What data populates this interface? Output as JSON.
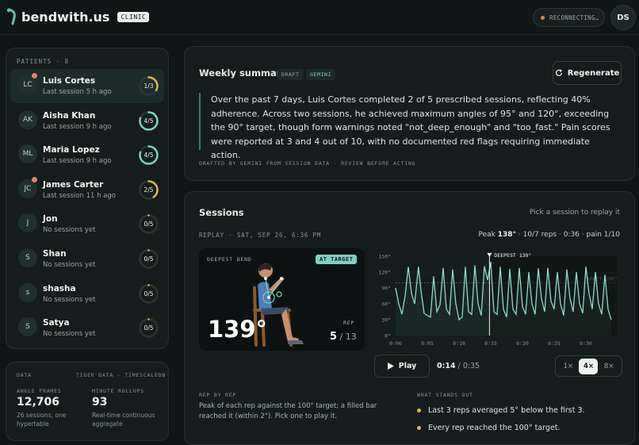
{
  "brand": {
    "name": "bendwith.us",
    "badge": "CLINIC"
  },
  "status": {
    "label": "RECONNECTING…"
  },
  "user": {
    "initials": "DS"
  },
  "patients": {
    "header": "PATIENTS · 8",
    "items": [
      {
        "initials": "LC",
        "name": "Luis Cortes",
        "sub": "Last session 5 h ago",
        "progress": "1/3",
        "fraction": 0.33,
        "color": "#e0b553",
        "alert": true,
        "active": true
      },
      {
        "initials": "AK",
        "name": "Aisha Khan",
        "sub": "Last session 9 h ago",
        "progress": "4/5",
        "fraction": 0.8,
        "color": "#7fd1c2",
        "alert": false
      },
      {
        "initials": "ML",
        "name": "Maria Lopez",
        "sub": "Last session 9 h ago",
        "progress": "4/5",
        "fraction": 0.8,
        "color": "#7fd1c2",
        "alert": false
      },
      {
        "initials": "JC",
        "name": "James Carter",
        "sub": "Last session 11 h ago",
        "progress": "2/5",
        "fraction": 0.4,
        "color": "#e0b553",
        "alert": true
      },
      {
        "initials": "J",
        "name": "Jon",
        "sub": "No sessions yet",
        "progress": "0/5",
        "fraction": 0,
        "color": "#e0b553",
        "alert": false
      },
      {
        "initials": "S",
        "name": "Shan",
        "sub": "No sessions yet",
        "progress": "0/5",
        "fraction": 0,
        "color": "#e0b553",
        "alert": false
      },
      {
        "initials": "s",
        "name": "shasha",
        "sub": "No sessions yet",
        "progress": "0/5",
        "fraction": 0,
        "color": "#e0b553",
        "alert": false
      },
      {
        "initials": "S",
        "name": "Satya",
        "sub": "No sessions yet",
        "progress": "0/5",
        "fraction": 0,
        "color": "#e0b553",
        "alert": false
      }
    ]
  },
  "data_panel": {
    "header_left": "DATA",
    "header_right": "TIGER DATA · TIMESCALEDB",
    "angle_label": "ANGLE FRAMES",
    "angle_value": "12,706",
    "angle_note": "26 sessions, one hypertable",
    "rollup_label": "MINUTE ROLLUPS",
    "rollup_value": "93",
    "rollup_note": "Real-time continuous aggregate"
  },
  "summary": {
    "title": "Weekly summary",
    "tag_draft": "DRAFT",
    "tag_gemini": "GEMINI",
    "regenerate": "Regenerate",
    "text": "Over the past 7 days, Luis Cortes completed 2 of 5 prescribed sessions, reflecting 40% adherence. Across two sessions, he achieved maximum angles of 95° and 120°, exceeding the 90° target, though form warnings noted \"not_deep_enough\" and \"too_fast.\" Pain scores were reported at 3 and 4 out of 10, with no documented red flags requiring immediate action.",
    "footer": "DRAFTED BY GEMINI FROM SESSION DATA · REVIEW BEFORE ACTING"
  },
  "sessions": {
    "title": "Sessions",
    "hint": "Pick a session to replay it",
    "replay": "REPLAY · SAT, SEP 26, 6:36 PM",
    "stats_prefix": "Peak ",
    "stats_peak": "138°",
    "stats_rest": " · 10/7 reps · 0:36 · pain 1/10",
    "video": {
      "deepest": "DEEPEST BEND",
      "badge": "AT TARGET",
      "angle": "139°",
      "rep_label": "REP",
      "rep": "5",
      "rep_total": " / 13"
    },
    "play": "Play",
    "time_current": "0:14",
    "time_total": " / 0:35",
    "speeds": [
      "1×",
      "4×",
      "8×"
    ],
    "speed_selected": 1,
    "rep_by_rep_header": "REP BY REP",
    "rep_by_rep_text": "Peak of each rep against the 100° target; a filled bar reached it (within 2°). Pick one to play it.",
    "stands_out_header": "WHAT STANDS OUT",
    "stands_out": [
      "Last 3 reps averaged 5° below the first 3.",
      "Every rep reached the 100° target."
    ]
  },
  "chart_data": {
    "type": "line",
    "title": "",
    "xlabel": "",
    "ylabel": "",
    "x_ticks": [
      "0:00",
      "0:05",
      "0:10",
      "0:15",
      "0:20",
      "0:25",
      "0:30"
    ],
    "y_ticks": [
      "150°",
      "120°",
      "90°",
      "60°",
      "30°",
      "0°"
    ],
    "xlim": [
      0,
      35
    ],
    "ylim": [
      0,
      150
    ],
    "target": {
      "value": 100,
      "label": "TARGET 100°"
    },
    "marker": {
      "x": 14.8,
      "label": "DEEPEST 139°"
    },
    "series": [
      {
        "x": [
          0,
          0.5,
          1,
          1.5,
          2,
          2.5,
          3,
          3.6,
          4,
          4.5,
          5,
          5.5,
          6,
          6.5,
          7,
          7.5,
          8,
          8.5,
          9,
          9.5,
          10,
          10.5,
          11,
          11.5,
          12,
          12.5,
          13,
          13.5,
          14,
          14.5,
          15,
          15.5,
          16,
          16.5,
          17,
          17.5,
          18,
          18.5,
          19,
          19.5,
          20,
          20.5,
          21,
          21.5,
          22,
          22.5,
          23,
          23.5,
          24,
          24.5,
          25,
          25.5,
          26,
          26.5,
          27,
          27.5,
          28,
          28.5,
          29,
          29.5,
          30,
          30.5,
          31,
          31.5,
          32,
          32.5,
          33,
          33.5,
          34
        ],
        "y": [
          90,
          60,
          40,
          75,
          130,
          80,
          60,
          130,
          85,
          42,
          38,
          35,
          112,
          45,
          58,
          128,
          50,
          40,
          125,
          60,
          30,
          35,
          130,
          45,
          40,
          133,
          60,
          38,
          131,
          105,
          139,
          45,
          40,
          130,
          50,
          35,
          126,
          50,
          40,
          128,
          55,
          40,
          120,
          60,
          40,
          127,
          70,
          45,
          128,
          65,
          50,
          120,
          60,
          38,
          125,
          70,
          45,
          120,
          60,
          42,
          130,
          80,
          50,
          120,
          60,
          40,
          115,
          50,
          30
        ]
      }
    ]
  }
}
